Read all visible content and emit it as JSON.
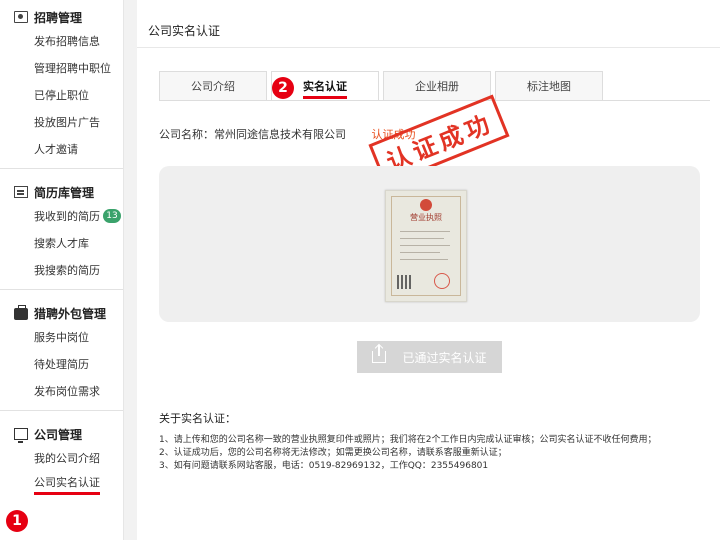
{
  "sidebar": {
    "sections": [
      {
        "title": "招聘管理",
        "icon": "user-card-icon",
        "items": [
          {
            "label": "发布招聘信息"
          },
          {
            "label": "管理招聘中职位"
          },
          {
            "label": "已停止职位"
          },
          {
            "label": "投放图片广告"
          },
          {
            "label": "人才邀请"
          }
        ]
      },
      {
        "title": "简历库管理",
        "icon": "document-icon",
        "items": [
          {
            "label": "我收到的简历",
            "badge": "13"
          },
          {
            "label": "搜索人才库"
          },
          {
            "label": "我搜索的简历"
          }
        ]
      },
      {
        "title": "猎聘外包管理",
        "icon": "briefcase-icon",
        "items": [
          {
            "label": "服务中岗位"
          },
          {
            "label": "待处理简历"
          },
          {
            "label": "发布岗位需求"
          }
        ]
      },
      {
        "title": "公司管理",
        "icon": "monitor-icon",
        "items": [
          {
            "label": "我的公司介绍"
          },
          {
            "label": "公司实名认证"
          }
        ]
      }
    ],
    "marker": "1"
  },
  "main": {
    "title": "公司实名认证",
    "tabs": [
      {
        "label": "公司介绍"
      },
      {
        "label": "实名认证"
      },
      {
        "label": "企业相册"
      },
      {
        "label": "标注地图"
      }
    ],
    "tab_marker": "2",
    "company_label": "公司名称：常州同途信息技术有限公司",
    "status": "认证成功",
    "stamp": "认证成功",
    "license_title": "营业执照",
    "verified_button": "已通过实名认证",
    "about_title": "关于实名认证：",
    "about_lines": [
      "1、请上传和您的公司名称一致的营业执照复印件或照片；我们将在2个工作日内完成认证审核；公司实名认证不收任何费用；",
      "2、认证成功后，您的公司名称将无法修改；如需更换公司名称，请联系客服重新认证；",
      "3、如有问题请联系网站客服，电话：0519-82969132，工作QQ：2355496801"
    ]
  }
}
